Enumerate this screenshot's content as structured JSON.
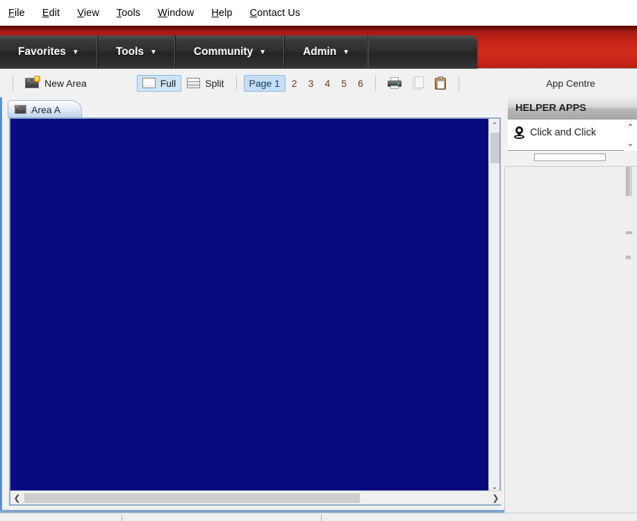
{
  "menubar": {
    "items": [
      {
        "mnemonic": "F",
        "rest": "ile",
        "name": "menu-file"
      },
      {
        "mnemonic": "E",
        "rest": "dit",
        "name": "menu-edit"
      },
      {
        "mnemonic": "V",
        "rest": "iew",
        "name": "menu-view"
      },
      {
        "mnemonic": "T",
        "rest": "ools",
        "name": "menu-tools"
      },
      {
        "mnemonic": "W",
        "rest": "indow",
        "name": "menu-window"
      },
      {
        "mnemonic": "H",
        "rest": "elp",
        "name": "menu-help"
      },
      {
        "mnemonic": "C",
        "rest": "ontact Us",
        "name": "menu-contact-us"
      }
    ]
  },
  "navbar": {
    "caret": "▼",
    "items": [
      {
        "label": "Favorites",
        "name": "nav-favorites"
      },
      {
        "label": "Tools",
        "name": "nav-tools"
      },
      {
        "label": "Community",
        "name": "nav-community"
      },
      {
        "label": "Admin",
        "name": "nav-admin"
      }
    ]
  },
  "toolbar": {
    "new_area_label": "New Area",
    "full_label": "Full",
    "split_label": "Split",
    "pages": [
      "Page 1",
      "2",
      "3",
      "4",
      "5",
      "6"
    ],
    "selected_page": "Page 1",
    "selected_view": "Full",
    "print_title": "Print",
    "copy_title": "Copy",
    "paste_title": "Paste"
  },
  "app_centre": {
    "label": "App Centre"
  },
  "document_window": {
    "tabs": [
      {
        "label": "Area A",
        "name": "tab-area-a"
      }
    ],
    "canvas_color": "#080b80",
    "vscroll": {
      "up": "⌃",
      "down": "⌄"
    },
    "hscroll": {
      "left": "❮",
      "right": "❯"
    }
  },
  "right_panel": {
    "header": "HELPER APPS",
    "apps": [
      {
        "label": "Click and Click",
        "name": "app-click-and-click"
      }
    ],
    "scroll": {
      "up": "⌃",
      "down": "⌄"
    }
  },
  "colors": {
    "banner_red": "#c32317",
    "nav_dark": "#2c2c2c",
    "canvas_blue": "#080b80",
    "selection_blue": "#c5ddf5",
    "window_border": "#5b8fc9"
  }
}
